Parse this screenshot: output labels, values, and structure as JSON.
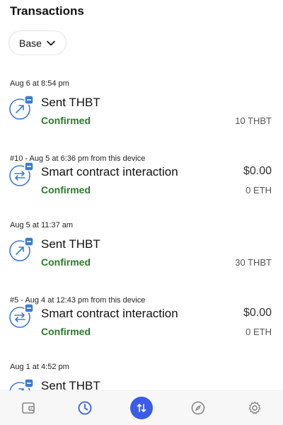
{
  "header": {
    "title": "Transactions"
  },
  "network_selector": {
    "label": "Base",
    "icon": "chevron-down-icon"
  },
  "transactions": [
    {
      "meta": "Aug 6 at 8:54 pm",
      "type": "send",
      "title": "Sent THBT",
      "status": "Confirmed",
      "fiat": "",
      "amount": "10 THBT"
    },
    {
      "meta": "#10 - Aug 5 at 6:36 pm from this device",
      "type": "contract",
      "title": "Smart contract interaction",
      "status": "Confirmed",
      "fiat": "$0.00",
      "amount": "0 ETH"
    },
    {
      "meta": "Aug 5 at 11:37 am",
      "type": "send",
      "title": "Sent THBT",
      "status": "Confirmed",
      "fiat": "",
      "amount": "30 THBT"
    },
    {
      "meta": "#5 - Aug 4 at 12:43 pm from this device",
      "type": "contract",
      "title": "Smart contract interaction",
      "status": "Confirmed",
      "fiat": "$0.00",
      "amount": "0 ETH"
    },
    {
      "meta": "Aug 1 at 4:52 pm",
      "type": "send",
      "title": "Sent THBT",
      "status": "",
      "fiat": "",
      "amount": ""
    }
  ],
  "tabbar": {
    "tabs": [
      {
        "name": "wallet",
        "icon": "wallet-icon",
        "active": false
      },
      {
        "name": "activity",
        "icon": "clock-icon",
        "active": false
      },
      {
        "name": "swap",
        "icon": "swap-arrows-icon",
        "active": true
      },
      {
        "name": "explore",
        "icon": "compass-icon",
        "active": false
      },
      {
        "name": "settings",
        "icon": "gear-icon",
        "active": false
      }
    ]
  },
  "colors": {
    "accent": "#3b5bea",
    "confirmed": "#2a7a2a",
    "icon_blue": "#3a7bd5"
  }
}
